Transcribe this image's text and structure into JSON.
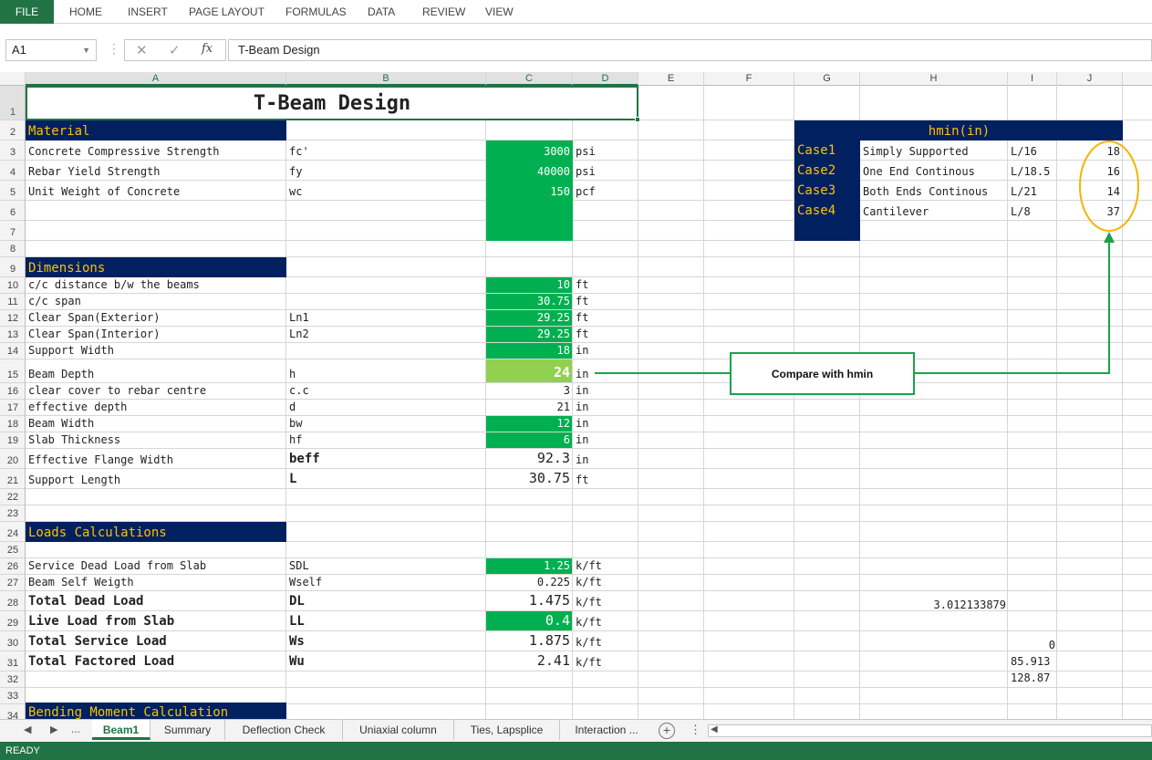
{
  "ribbon": {
    "tabs": [
      "FILE",
      "HOME",
      "INSERT",
      "PAGE LAYOUT",
      "FORMULAS",
      "DATA",
      "REVIEW",
      "VIEW"
    ]
  },
  "formula_bar": {
    "name_box": "A1",
    "fx_symbol": "fx",
    "content": "T-Beam Design"
  },
  "columns": [
    "A",
    "B",
    "C",
    "D",
    "E",
    "F",
    "G",
    "H",
    "I",
    "J"
  ],
  "rows": [
    "1",
    "2",
    "3",
    "4",
    "5",
    "6",
    "7",
    "8",
    "9",
    "10",
    "11",
    "12",
    "13",
    "14",
    "15",
    "16",
    "17",
    "18",
    "19",
    "20",
    "21",
    "22",
    "23",
    "24",
    "25",
    "26",
    "27",
    "28",
    "29",
    "30",
    "31",
    "32",
    "33",
    "34"
  ],
  "title": "T-Beam Design",
  "material": {
    "header": "Material",
    "rows": [
      {
        "label": "Concrete Compressive Strength",
        "symbol": "fc'",
        "value": "3000",
        "unit": "psi"
      },
      {
        "label": "Rebar Yield Strength",
        "symbol": "fy",
        "value": "40000",
        "unit": "psi"
      },
      {
        "label": "Unit Weight of Concrete",
        "symbol": "wc",
        "value": "150",
        "unit": "pcf"
      }
    ]
  },
  "dimensions": {
    "header": "Dimensions",
    "rows": [
      {
        "label": "c/c distance b/w the beams",
        "symbol": "",
        "value": "10",
        "unit": "ft"
      },
      {
        "label": "c/c span",
        "symbol": "",
        "value": "30.75",
        "unit": "ft"
      },
      {
        "label": "Clear Span(Exterior)",
        "symbol": "Ln1",
        "value": "29.25",
        "unit": "ft"
      },
      {
        "label": "Clear Span(Interior)",
        "symbol": "Ln2",
        "value": "29.25",
        "unit": "ft"
      },
      {
        "label": "Support Width",
        "symbol": "",
        "value": "18",
        "unit": "in"
      },
      {
        "label": "Beam Depth",
        "symbol": "h",
        "value": "24",
        "unit": "in"
      },
      {
        "label": "clear cover to rebar centre",
        "symbol": "c.c",
        "value": "3",
        "unit": "in"
      },
      {
        "label": "effective depth",
        "symbol": "d",
        "value": "21",
        "unit": "in"
      },
      {
        "label": "Beam Width",
        "symbol": "bw",
        "value": "12",
        "unit": "in"
      },
      {
        "label": "Slab Thickness",
        "symbol": "hf",
        "value": "6",
        "unit": "in"
      },
      {
        "label": "Effective Flange Width",
        "symbol": "beff",
        "value": "92.3",
        "unit": "in"
      },
      {
        "label": "Support Length",
        "symbol": "L",
        "value": "30.75",
        "unit": "ft"
      }
    ]
  },
  "loads": {
    "header": "Loads Calculations",
    "rows": [
      {
        "label": "Service Dead Load from Slab",
        "symbol": "SDL",
        "value": "1.25",
        "unit": "k/ft"
      },
      {
        "label": "Beam Self Weigth",
        "symbol": "Wself",
        "value": "0.225",
        "unit": "k/ft"
      },
      {
        "label": "Total Dead Load",
        "symbol": "DL",
        "value": "1.475",
        "unit": "k/ft"
      },
      {
        "label": "Live Load from Slab",
        "symbol": "LL",
        "value": "0.4",
        "unit": "k/ft"
      },
      {
        "label": "Total Service Load",
        "symbol": "Ws",
        "value": "1.875",
        "unit": "k/ft"
      },
      {
        "label": "Total Factored Load",
        "symbol": "Wu",
        "value": "2.41",
        "unit": "k/ft"
      }
    ],
    "stray_h28": "3.012133879",
    "stray_i30": "0",
    "stray_i31": "85.913",
    "stray_i32": "128.87"
  },
  "bending": {
    "header": "Bending Moment Calculation"
  },
  "hmin": {
    "header": "hmin(in)",
    "cases": [
      {
        "case": "Case1",
        "support": "Simply Supported",
        "ratio": "L/16",
        "value": "18"
      },
      {
        "case": "Case2",
        "support": "One End Continous",
        "ratio": "L/18.5",
        "value": "16"
      },
      {
        "case": "Case3",
        "support": "Both Ends Continous",
        "ratio": "L/21",
        "value": "14"
      },
      {
        "case": "Case4",
        "support": "Cantilever",
        "ratio": "L/8",
        "value": "37"
      }
    ]
  },
  "callout": {
    "text": "Compare with hmin"
  },
  "sheets": {
    "ellipsis": "...",
    "tabs": [
      "Beam1",
      "Summary",
      "Deflection Check",
      "Uniaxial column",
      "Ties, Lapsplice",
      "Interaction ..."
    ],
    "active": "Beam1"
  },
  "status": {
    "text": "READY"
  },
  "colors": {
    "excel_green": "#217346",
    "navy": "#002060",
    "gold": "#ffc000",
    "cell_green": "#00b050",
    "light_green": "#92d050",
    "callout_green": "#1aa24c",
    "ellipse_orange": "#f5b400"
  }
}
